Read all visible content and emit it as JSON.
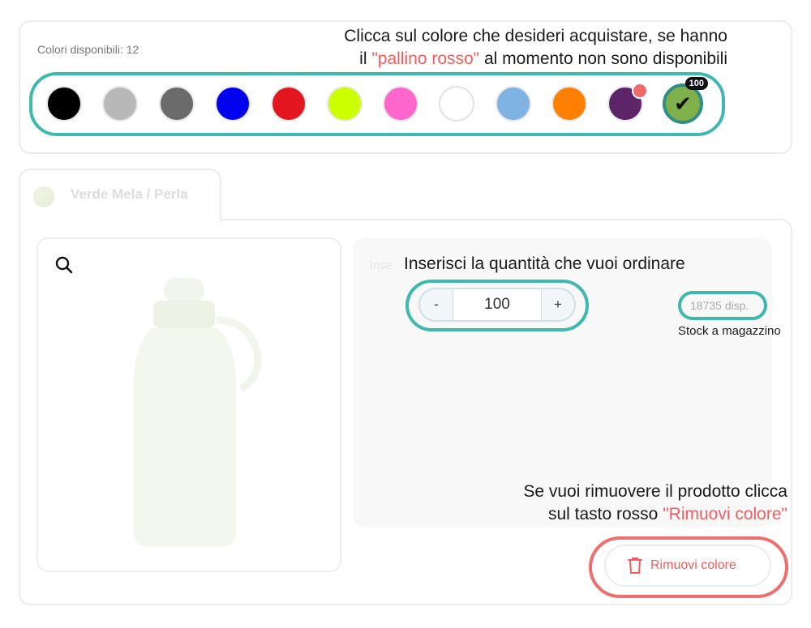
{
  "colors": {
    "label": "Colori disponibili: 12",
    "annotation_line1": "Clicca sul colore che desideri acquistare, se hanno",
    "annotation_line2_prefix": "il ",
    "annotation_line2_highlight": "\"pallino rosso\"",
    "annotation_line2_suffix": " al momento non sono disponibili",
    "swatches": [
      {
        "hex": "#000000",
        "available": true
      },
      {
        "hex": "#b8b8b8",
        "available": true
      },
      {
        "hex": "#6b6b6b",
        "available": true
      },
      {
        "hex": "#0000ee",
        "available": true
      },
      {
        "hex": "#e3151f",
        "available": true
      },
      {
        "hex": "#ccff00",
        "available": true
      },
      {
        "hex": "#ff66cc",
        "available": true
      },
      {
        "hex": "#ffffff",
        "available": true
      },
      {
        "hex": "#7fb3e3",
        "available": true
      },
      {
        "hex": "#ff8000",
        "available": true
      },
      {
        "hex": "#5e2468",
        "available": false
      },
      {
        "hex": "#7fb04a",
        "available": true,
        "selected": true,
        "quantity_badge": "100"
      }
    ]
  },
  "tab": {
    "label": "Verde Mela / Perla"
  },
  "product": {
    "quantity": {
      "annotation": "Inserisci la quantità che vuoi ordinare",
      "minus": "-",
      "plus": "+",
      "value": "100"
    },
    "stock": {
      "text": "18735 disp.",
      "caption": "Stock a magazzino"
    },
    "remove": {
      "annotation_line1": "Se vuoi rimuovere il prodotto clicca",
      "annotation_line2_prefix": "sul tasto rosso ",
      "annotation_line2_highlight": "\"Rimuovi colore\"",
      "button_label": "Rimuovi colore"
    },
    "faint_label": "Inse"
  },
  "accent_colors": {
    "highlight": "#3fb8ad",
    "remove": "#ef5f5f"
  }
}
